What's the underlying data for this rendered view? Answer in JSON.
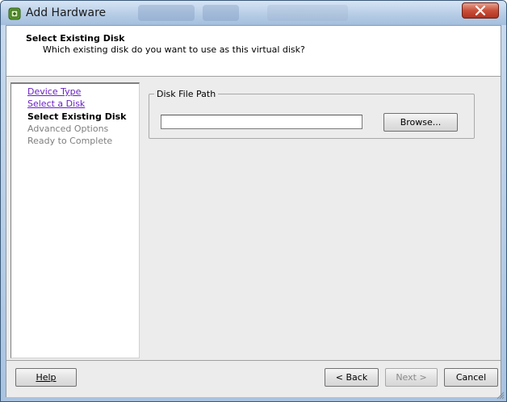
{
  "window": {
    "title": "Add Hardware"
  },
  "header": {
    "title": "Select Existing Disk",
    "subtitle": "Which existing disk do you want to use as this virtual disk?"
  },
  "steps": [
    {
      "label": "Device Type",
      "state": "link"
    },
    {
      "label": "Select a Disk",
      "state": "link"
    },
    {
      "label": "Select Existing Disk",
      "state": "current"
    },
    {
      "label": "Advanced Options",
      "state": "disabled"
    },
    {
      "label": "Ready to Complete",
      "state": "disabled"
    }
  ],
  "disk_group": {
    "legend": "Disk File Path",
    "path_value": "",
    "browse_label": "Browse..."
  },
  "footer": {
    "help_label": "Help",
    "back_label": "< Back",
    "next_label": "Next >",
    "cancel_label": "Cancel"
  },
  "colors": {
    "link": "#6a1fc8",
    "disabled_text": "#7f7f7f",
    "client_bg": "#ececec"
  }
}
